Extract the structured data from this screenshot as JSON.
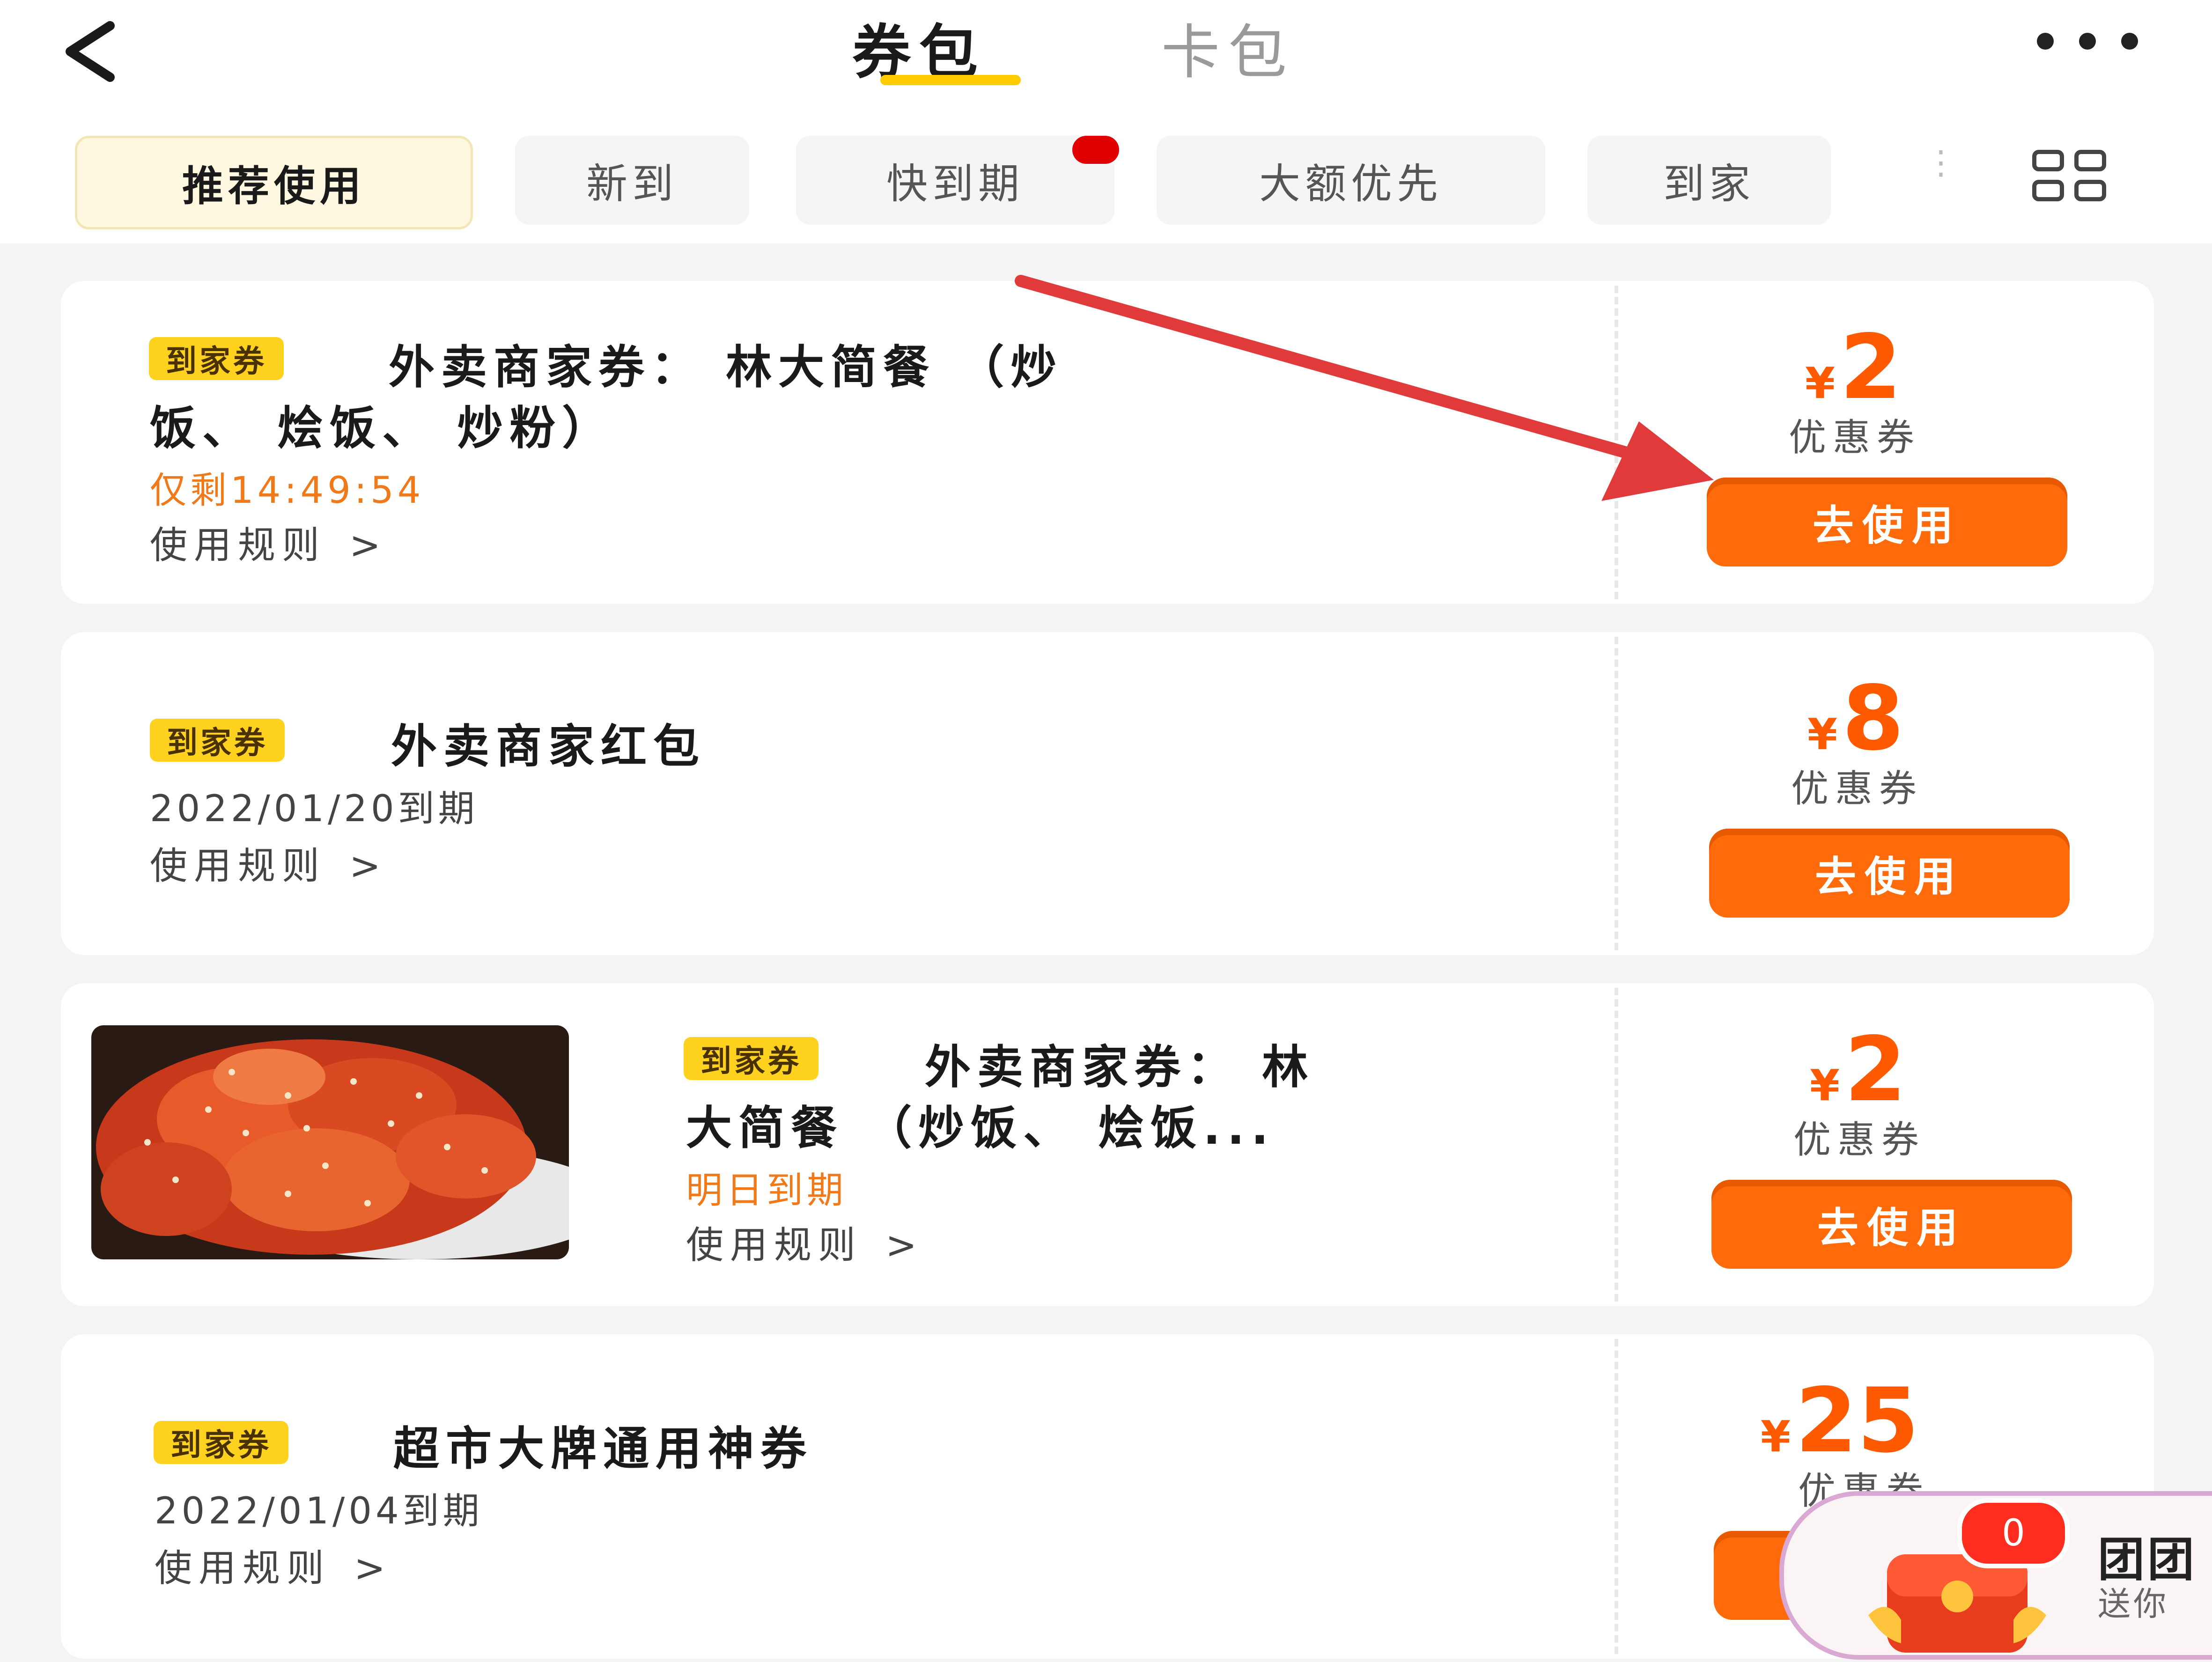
{
  "header": {
    "tabs": [
      {
        "label": "券包",
        "active": true
      },
      {
        "label": "卡包",
        "active": false
      }
    ]
  },
  "filters": {
    "items": [
      {
        "label": "推荐使用",
        "active": true
      },
      {
        "label": "新到",
        "active": false
      },
      {
        "label": "快到期",
        "active": false,
        "has_dot": true
      },
      {
        "label": "大额优先",
        "active": false
      },
      {
        "label": "到家",
        "active": false
      }
    ]
  },
  "coupons": [
    {
      "tag": "到家券",
      "title_line1": "外卖商家券： 林大简餐 （炒",
      "title_line2": "饭、 烩饭、 炒粉）",
      "expiry": "仅剩14:49:54",
      "rules": "使用规则",
      "currency": "¥",
      "amount": "2",
      "label": "优惠券",
      "button": "去使用"
    },
    {
      "tag": "到家券",
      "title_line1": "外卖商家红包",
      "expiry": "2022/01/20到期",
      "rules": "使用规则",
      "currency": "¥",
      "amount": "8",
      "label": "优惠券",
      "button": "去使用"
    },
    {
      "tag": "到家券",
      "title_line1": "外卖商家券： 林",
      "title_line2": "大简餐 （炒饭、 烩饭...",
      "expiry": "明日到期",
      "rules": "使用规则",
      "currency": "¥",
      "amount": "2",
      "label": "优惠券",
      "button": "去使用"
    },
    {
      "tag": "到家券",
      "title_line1": "超市大牌通用神券",
      "expiry": "2022/01/04到期",
      "rules": "使用规则",
      "currency": "¥",
      "amount": "25",
      "label": "优惠券"
    }
  ],
  "promo": {
    "badge": "0",
    "title": "团团",
    "subtitle": "送你"
  },
  "colors": {
    "accent": "#ff6a0a",
    "price": "#ff5a00",
    "tag_bg": "#ffd21f",
    "tab_underline": "#ffcc00",
    "annotation_arrow": "#e03a3a"
  }
}
